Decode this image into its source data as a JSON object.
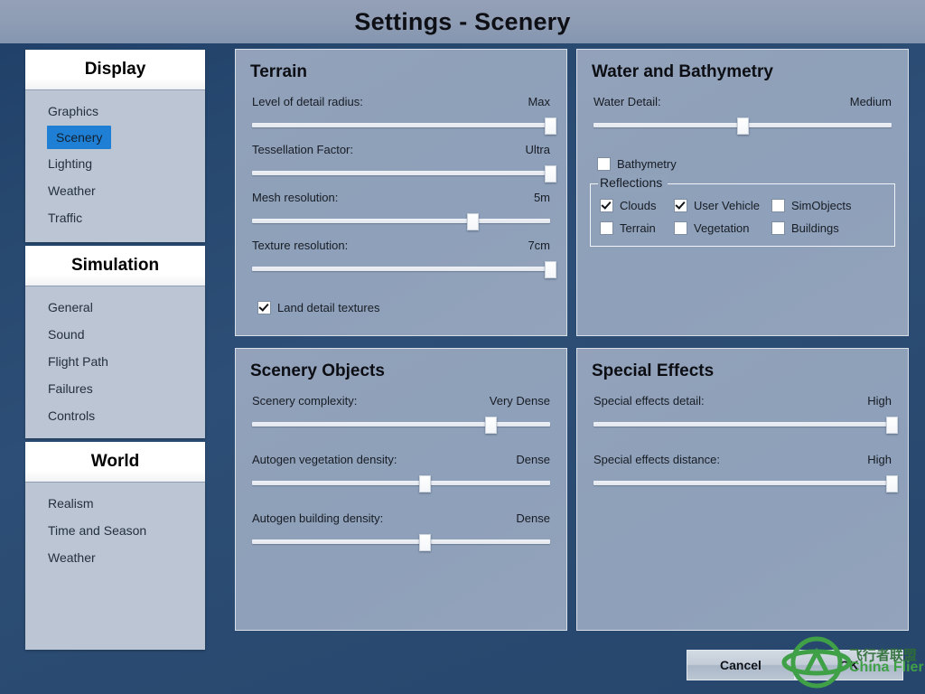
{
  "window": {
    "title": "Settings - Scenery"
  },
  "colors": {
    "accent_selected": "#1e7fd4",
    "background_navy": "#27486f",
    "panel_blue_grey": "#90a1ba",
    "sidebar_body": "#bcc5d3",
    "watermark_green": "#3fa047"
  },
  "sidebar": {
    "groups": [
      {
        "header": "Display",
        "items": [
          {
            "label": "Graphics",
            "selected": false
          },
          {
            "label": "Scenery",
            "selected": true
          },
          {
            "label": "Lighting",
            "selected": false
          },
          {
            "label": "Weather",
            "selected": false
          },
          {
            "label": "Traffic",
            "selected": false
          }
        ]
      },
      {
        "header": "Simulation",
        "items": [
          {
            "label": "General",
            "selected": false
          },
          {
            "label": "Sound",
            "selected": false
          },
          {
            "label": "Flight Path",
            "selected": false
          },
          {
            "label": "Failures",
            "selected": false
          },
          {
            "label": "Controls",
            "selected": false
          }
        ]
      },
      {
        "header": "World",
        "items": [
          {
            "label": "Realism",
            "selected": false
          },
          {
            "label": "Time and Season",
            "selected": false
          },
          {
            "label": "Weather",
            "selected": false
          }
        ]
      }
    ]
  },
  "panels": {
    "terrain": {
      "title": "Terrain",
      "sliders": [
        {
          "label": "Level of detail radius:",
          "value": "Max",
          "percent": 100
        },
        {
          "label": "Tessellation Factor:",
          "value": "Ultra",
          "percent": 100
        },
        {
          "label": "Mesh resolution:",
          "value": "5m",
          "percent": 74
        },
        {
          "label": "Texture resolution:",
          "value": "7cm",
          "percent": 100
        }
      ],
      "checkbox": {
        "label": "Land detail textures",
        "checked": true
      }
    },
    "water": {
      "title": "Water and Bathymetry",
      "sliders": [
        {
          "label": "Water Detail:",
          "value": "Medium",
          "percent": 50
        }
      ],
      "bathymetry": {
        "label": "Bathymetry",
        "checked": false
      },
      "reflections": {
        "legend": "Reflections",
        "items": [
          {
            "label": "Clouds",
            "checked": true
          },
          {
            "label": "User Vehicle",
            "checked": true
          },
          {
            "label": "SimObjects",
            "checked": false
          },
          {
            "label": "Terrain",
            "checked": false
          },
          {
            "label": "Vegetation",
            "checked": false
          },
          {
            "label": "Buildings",
            "checked": false
          }
        ]
      }
    },
    "scenery_objects": {
      "title": "Scenery Objects",
      "sliders": [
        {
          "label": "Scenery complexity:",
          "value": "Very Dense",
          "percent": 80
        },
        {
          "label": "Autogen vegetation density:",
          "value": "Dense",
          "percent": 58
        },
        {
          "label": "Autogen building density:",
          "value": "Dense",
          "percent": 58
        }
      ]
    },
    "special_effects": {
      "title": "Special Effects",
      "sliders": [
        {
          "label": "Special effects detail:",
          "value": "High",
          "percent": 100
        },
        {
          "label": "Special effects distance:",
          "value": "High",
          "percent": 100
        }
      ]
    }
  },
  "buttons": {
    "cancel": "Cancel",
    "ok": "OK"
  },
  "watermark": {
    "chinese": "飞行者联盟",
    "english": "China Flier"
  }
}
